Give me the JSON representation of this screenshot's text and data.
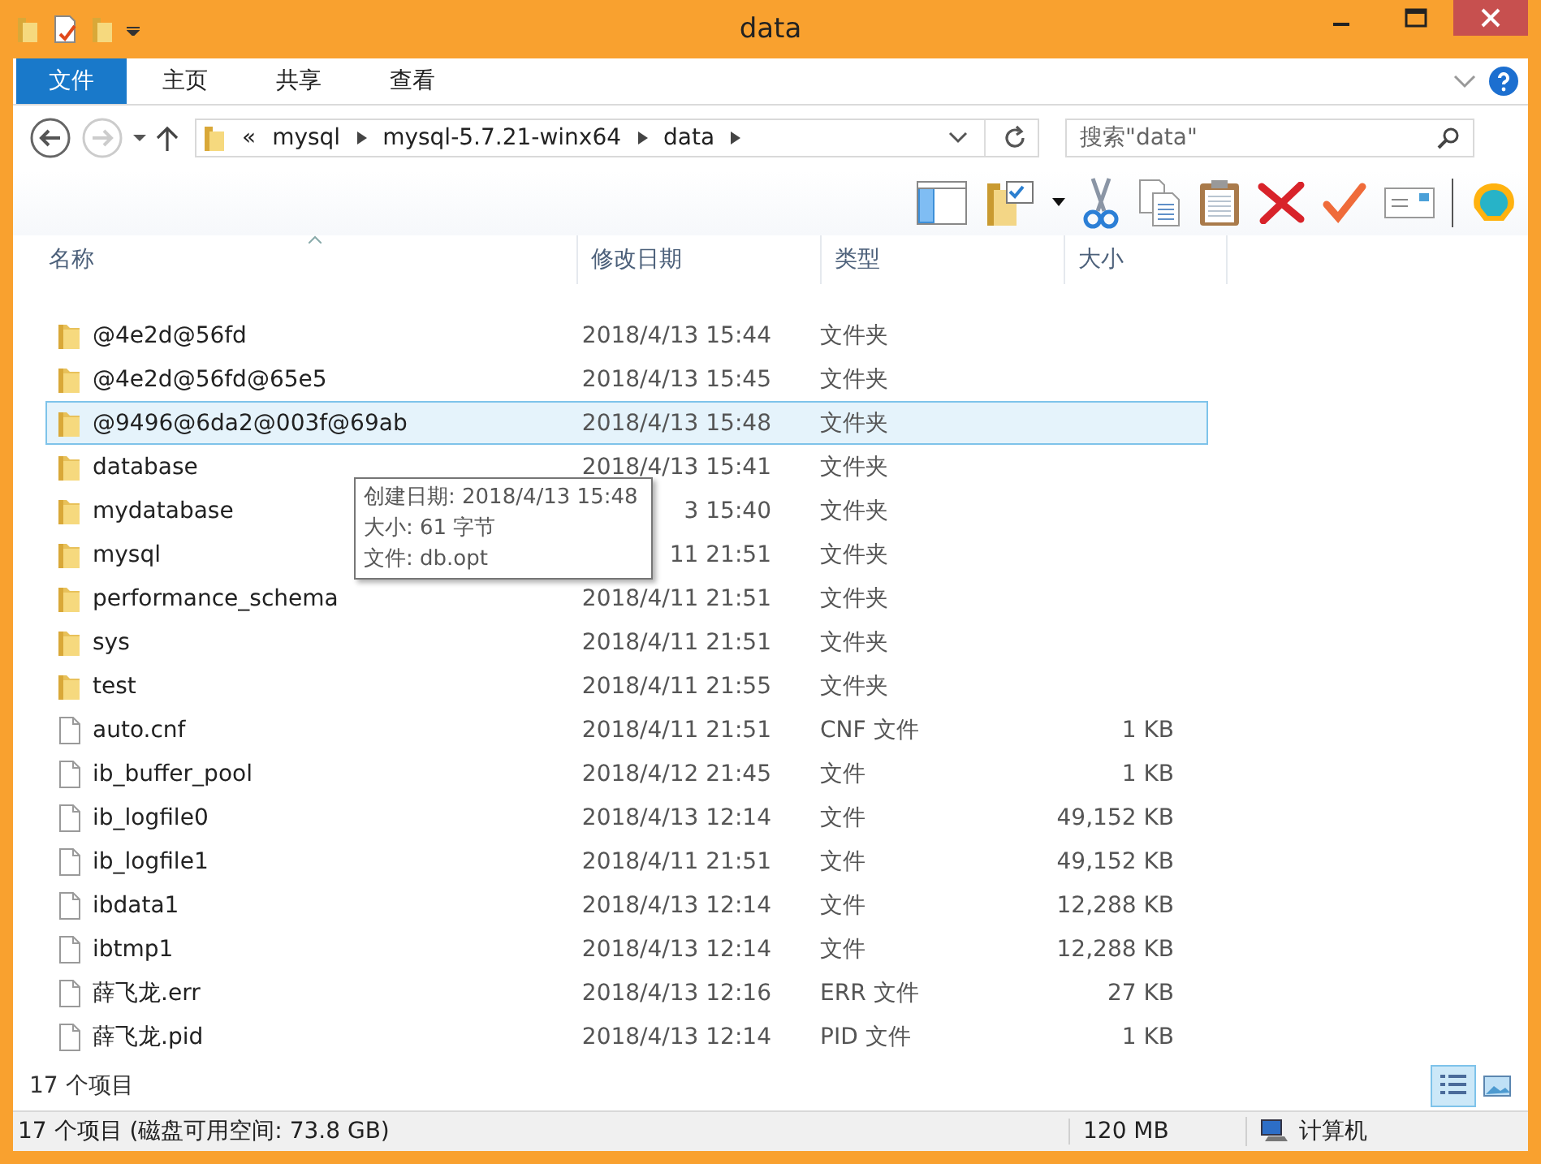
{
  "window": {
    "title": "data"
  },
  "ribbon_tabs": [
    {
      "label": "文件",
      "selected": true
    },
    {
      "label": "主页",
      "selected": false
    },
    {
      "label": "共享",
      "selected": false
    },
    {
      "label": "查看",
      "selected": false
    }
  ],
  "address": {
    "overflow": "«",
    "crumbs": [
      "mysql",
      "mysql-5.7.21-winx64",
      "data"
    ]
  },
  "search": {
    "placeholder": "搜索\"data\""
  },
  "columns": [
    "名称",
    "修改日期",
    "类型",
    "大小"
  ],
  "files": [
    {
      "kind": "folder",
      "name": "@4e2d@56fd",
      "date": "2018/4/13 15:44",
      "type": "文件夹",
      "selected": false
    },
    {
      "kind": "folder",
      "name": "@4e2d@56fd@65e5",
      "date": "2018/4/13 15:45",
      "type": "文件夹",
      "selected": false
    },
    {
      "kind": "folder",
      "name": "@9496@6da2@003f@69ab",
      "date": "2018/4/13 15:48",
      "type": "文件夹",
      "selected": true
    },
    {
      "kind": "folder",
      "name": "database",
      "date": "2018/4/13 15:41",
      "type": "文件夹",
      "selected": false
    },
    {
      "kind": "folder",
      "name": "mydatabase",
      "date": "3 15:40",
      "type": "文件夹",
      "selected": false
    },
    {
      "kind": "folder",
      "name": "mysql",
      "date": "11 21:51",
      "type": "文件夹",
      "selected": false
    },
    {
      "kind": "folder",
      "name": "performance_schema",
      "date": "2018/4/11 21:51",
      "type": "文件夹",
      "selected": false
    },
    {
      "kind": "folder",
      "name": "sys",
      "date": "2018/4/11 21:51",
      "type": "文件夹",
      "selected": false
    },
    {
      "kind": "folder",
      "name": "test",
      "date": "2018/4/11 21:55",
      "type": "文件夹",
      "selected": false
    },
    {
      "kind": "file",
      "name": "auto.cnf",
      "date": "2018/4/11 21:51",
      "type": "CNF 文件",
      "size": "1 KB",
      "selected": false
    },
    {
      "kind": "file",
      "name": "ib_buffer_pool",
      "date": "2018/4/12 21:45",
      "type": "文件",
      "size": "1 KB",
      "selected": false
    },
    {
      "kind": "file",
      "name": "ib_logfile0",
      "date": "2018/4/13 12:14",
      "type": "文件",
      "size": "49,152 KB",
      "selected": false
    },
    {
      "kind": "file",
      "name": "ib_logfile1",
      "date": "2018/4/11 21:51",
      "type": "文件",
      "size": "49,152 KB",
      "selected": false
    },
    {
      "kind": "file",
      "name": "ibdata1",
      "date": "2018/4/13 12:14",
      "type": "文件",
      "size": "12,288 KB",
      "selected": false
    },
    {
      "kind": "file",
      "name": "ibtmp1",
      "date": "2018/4/13 12:14",
      "type": "文件",
      "size": "12,288 KB",
      "selected": false
    },
    {
      "kind": "file",
      "name": "薛飞龙.err",
      "date": "2018/4/13 12:16",
      "type": "ERR 文件",
      "size": "27 KB",
      "selected": false
    },
    {
      "kind": "file",
      "name": "薛飞龙.pid",
      "date": "2018/4/13 12:14",
      "type": "PID 文件",
      "size": "1 KB",
      "selected": false
    }
  ],
  "tooltip": [
    "创建日期: 2018/4/13 15:48",
    "大小: 61 字节",
    "文件: db.opt"
  ],
  "item_count": "17 个项目",
  "status_bar": {
    "summary": "17 个项目 (磁盘可用空间: 73.8 GB)",
    "size": "120 MB",
    "location": "计算机"
  }
}
